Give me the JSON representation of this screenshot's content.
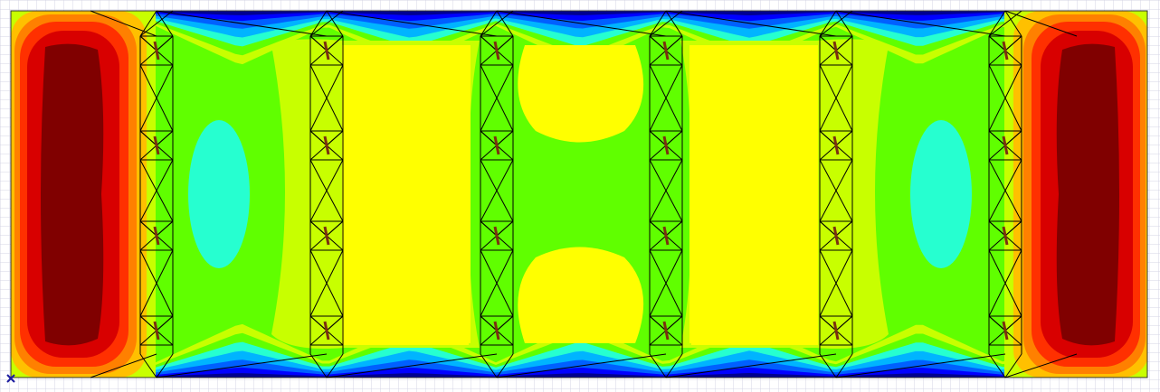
{
  "viewer": {
    "origin_marker_label": "",
    "colors": {
      "grid": "#d4d4e4",
      "mesh": "#000000",
      "strut": "#7a3010",
      "marker": "#1c1ca0"
    },
    "contour_palette": [
      "#000090",
      "#0000ff",
      "#0060ff",
      "#00b4ff",
      "#26ffd0",
      "#60ff00",
      "#c8ff00",
      "#ffff00",
      "#ffc000",
      "#ff8000",
      "#ff3000",
      "#d80000",
      "#800000"
    ]
  },
  "model": {
    "column_count": 6,
    "node_levels_per_column": 5
  }
}
